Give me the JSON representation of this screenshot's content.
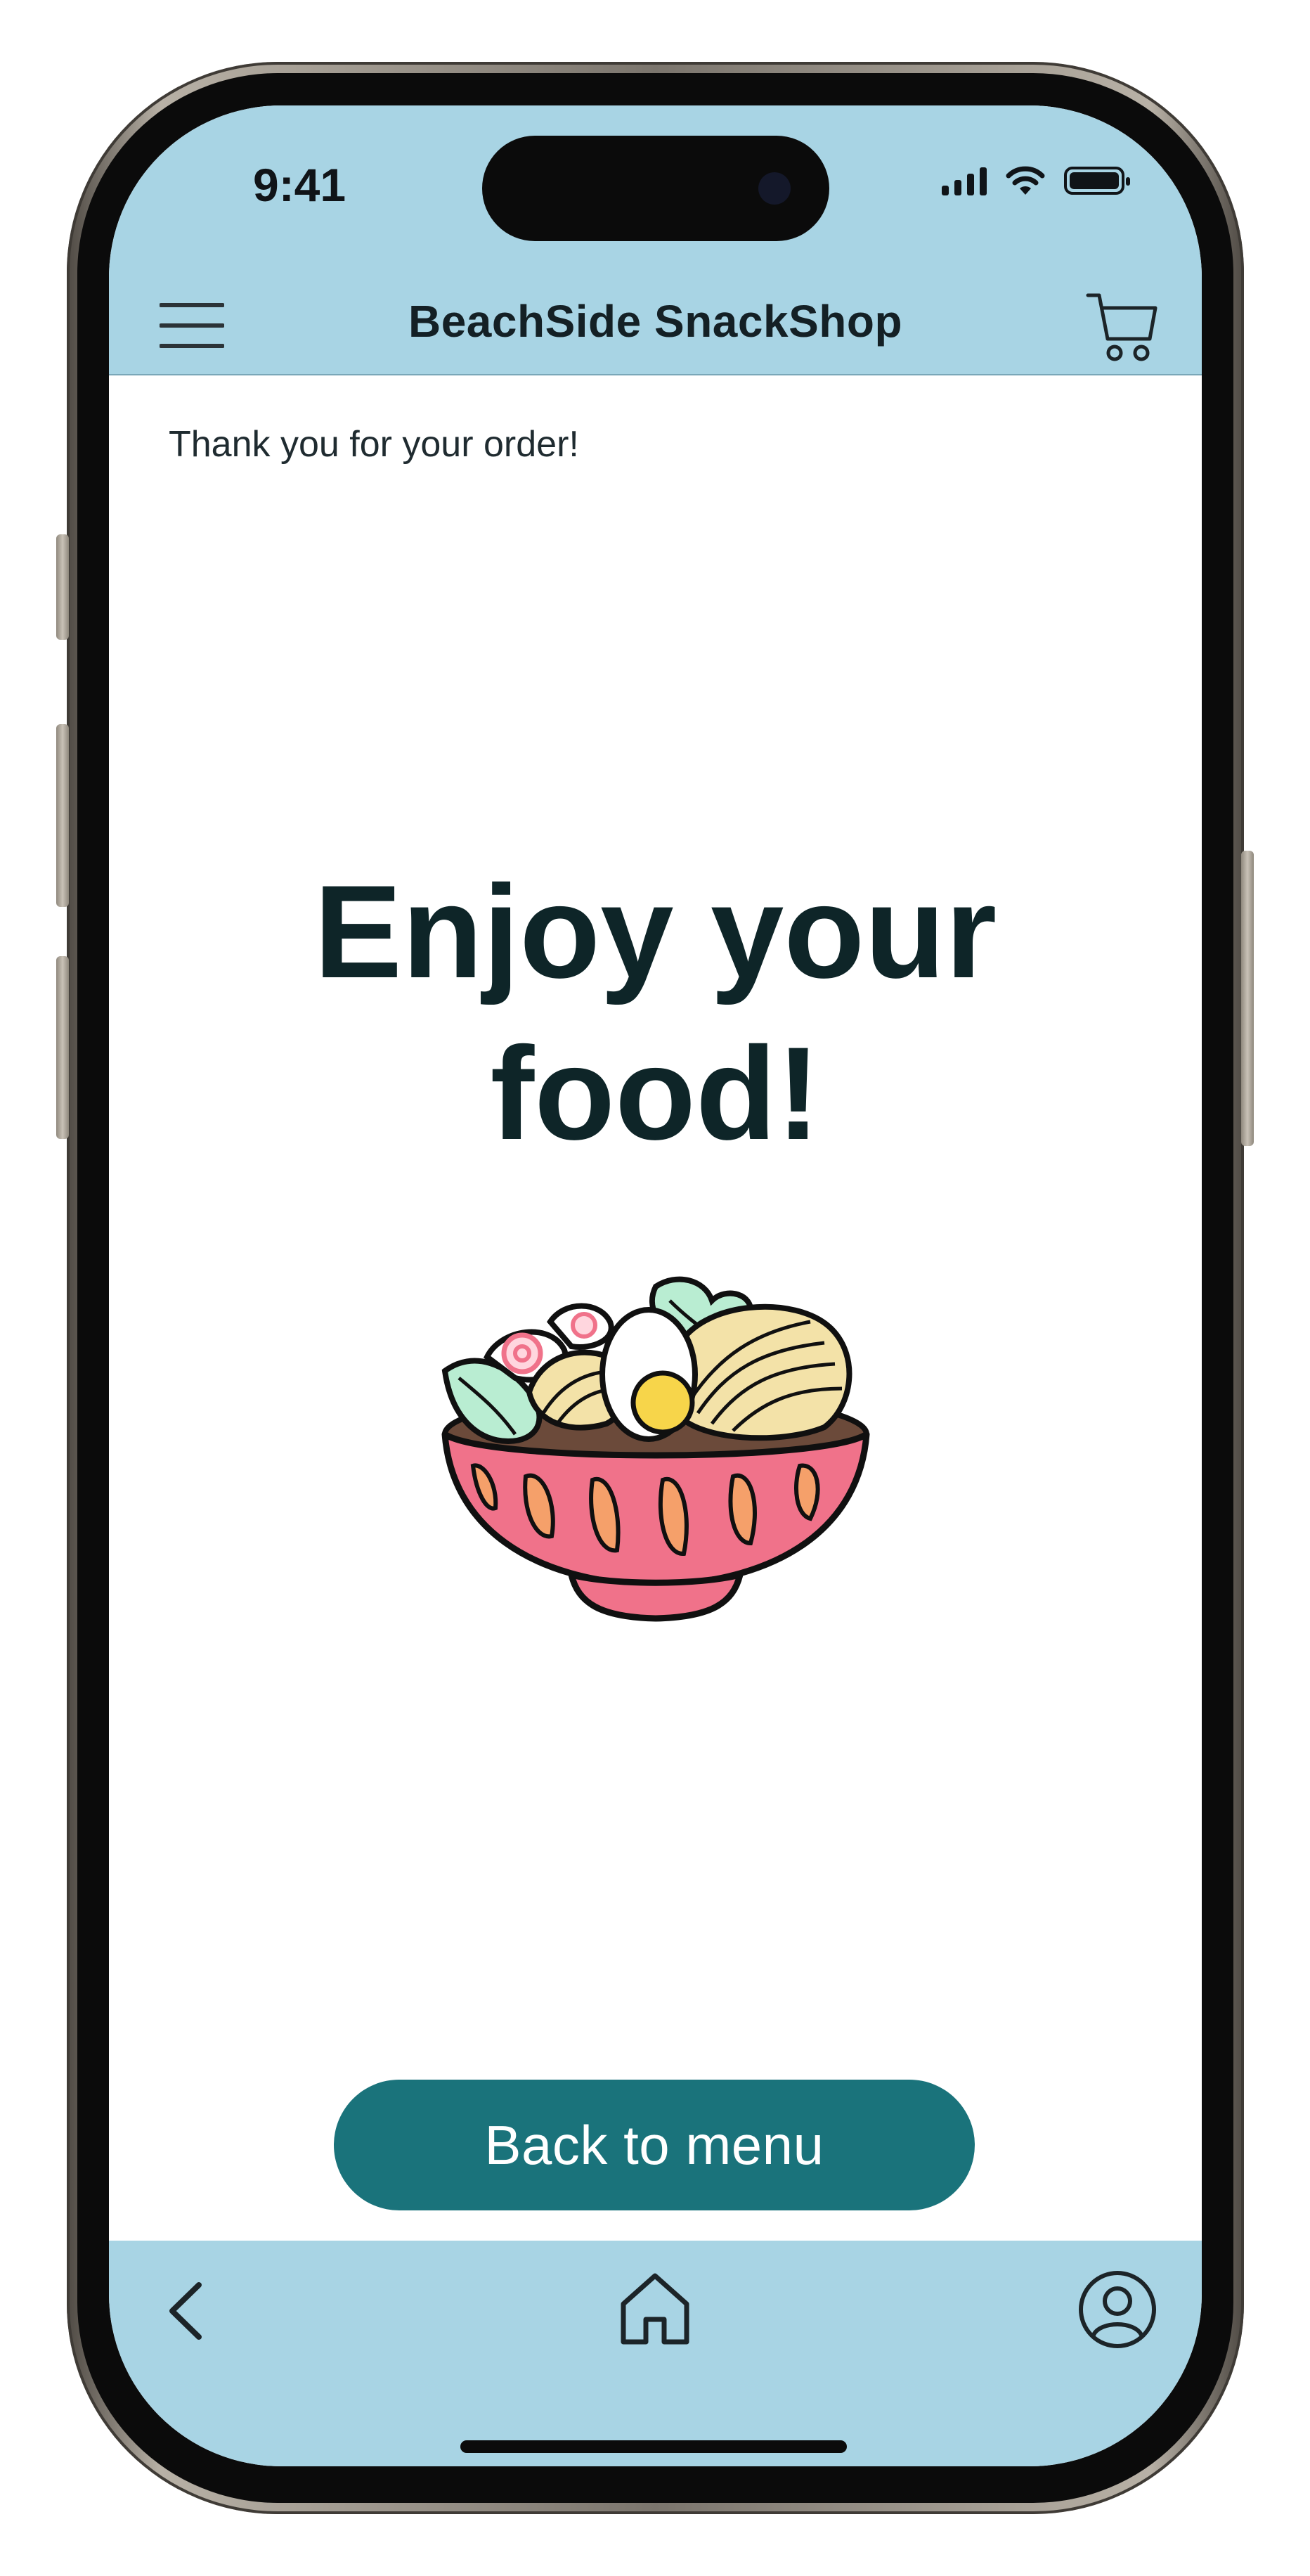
{
  "status_bar": {
    "time": "9:41",
    "battery_level": 1.0
  },
  "header": {
    "title": "BeachSide SnackShop",
    "menu_icon": "hamburger-menu-icon",
    "cart_icon": "shopping-cart-icon"
  },
  "main": {
    "thank_you": "Thank you for your order!",
    "headline_line1": "Enjoy your",
    "headline_line2": "food!",
    "illustration": "ramen-bowl-illustration",
    "back_button_label": "Back to menu"
  },
  "bottom_nav": {
    "back_icon": "chevron-left-icon",
    "home_icon": "home-icon",
    "profile_icon": "user-profile-icon"
  },
  "colors": {
    "bar_background": "#a8d4e4",
    "primary_button": "#1a737b",
    "headline_text": "#0e2528",
    "bowl_pink": "#f0728a",
    "bowl_orange": "#f5a06a",
    "leaf_green": "#b9edd2",
    "yolk_yellow": "#f7d54a"
  }
}
